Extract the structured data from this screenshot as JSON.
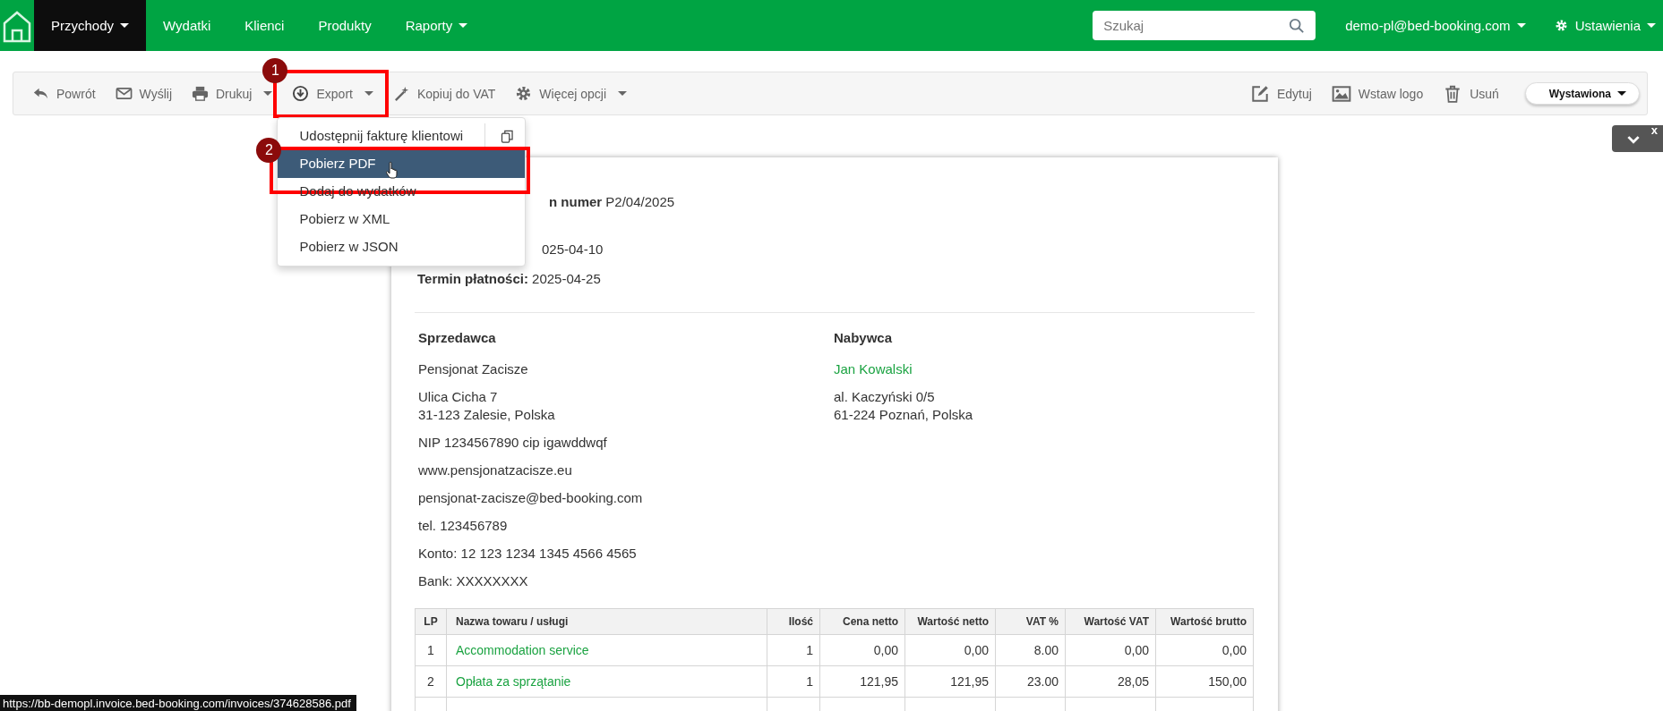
{
  "nav": {
    "items": [
      {
        "label": "Przychody",
        "caret": true,
        "selected": true
      },
      {
        "label": "Wydatki",
        "caret": false,
        "selected": false
      },
      {
        "label": "Klienci",
        "caret": false,
        "selected": false
      },
      {
        "label": "Produkty",
        "caret": false,
        "selected": false
      },
      {
        "label": "Raporty",
        "caret": true,
        "selected": false
      }
    ],
    "search": {
      "placeholder": "Szukaj"
    },
    "account": "demo-pl@bed-booking.com",
    "settings": "Ustawienia"
  },
  "toolbar": {
    "left": [
      {
        "label": "Powrót",
        "caret": false
      },
      {
        "label": "Wyślij",
        "caret": false
      },
      {
        "label": "Drukuj",
        "caret": true
      },
      {
        "label": "Export",
        "caret": true,
        "marker": "1"
      },
      {
        "label": "Kopiuj do VAT",
        "caret": false
      },
      {
        "label": "Więcej opcji",
        "caret": true
      }
    ],
    "right": [
      {
        "label": "Edytuj"
      },
      {
        "label": "Wstaw logo"
      },
      {
        "label": "Usuń"
      }
    ],
    "status": "Wystawiona"
  },
  "export_menu": {
    "items": [
      {
        "label": "Udostępnij fakturę klientowi",
        "kind": "share",
        "selected": false
      },
      {
        "label": "Pobierz PDF",
        "kind": "item",
        "selected": true,
        "marker": "2"
      },
      {
        "label": "Dodaj do wydatków",
        "kind": "item",
        "selected": false
      },
      {
        "label": "Pobierz w XML",
        "kind": "item",
        "selected": false
      },
      {
        "label": "Pobierz w JSON",
        "kind": "item",
        "selected": false
      }
    ]
  },
  "panel_toggle": {
    "close_label": "x"
  },
  "invoice": {
    "header": [
      {
        "text": "**n numer** P2/04/2025",
        "kind": "partial"
      },
      {
        "text": "025-04-10",
        "kind": "partial"
      },
      {
        "text": "**Termin płatności:** 2025-04-25",
        "kind": "full"
      }
    ],
    "seller": {
      "title": "Sprzedawca",
      "blocks": [
        [
          {
            "text": "Pensjonat Zacisze",
            "kind": "text"
          }
        ],
        [
          {
            "text": "Ulica Cicha 7",
            "kind": "text"
          },
          {
            "text": "31-123 Zalesie, Polska",
            "kind": "text"
          }
        ],
        [
          {
            "text": "NIP 1234567890 cip igawddwqf",
            "kind": "text"
          }
        ],
        [
          {
            "text": "www.pensjonatzacisze.eu",
            "kind": "text"
          }
        ],
        [
          {
            "text": "pensjonat-zacisze@bed-booking.com",
            "kind": "text"
          }
        ],
        [
          {
            "text": "tel. 123456789",
            "kind": "text"
          }
        ],
        [
          {
            "text": "Konto: 12 123 1234 1345 4566 4565",
            "kind": "text"
          }
        ],
        [
          {
            "text": "Bank: XXXXXXXX",
            "kind": "text"
          }
        ]
      ]
    },
    "buyer": {
      "title": "Nabywca",
      "blocks": [
        [
          {
            "text": "Jan Kowalski",
            "kind": "link"
          }
        ],
        [
          {
            "text": "al. Kaczyński 0/5",
            "kind": "text"
          },
          {
            "text": "61-224 Poznań, Polska",
            "kind": "text"
          }
        ]
      ]
    },
    "table": {
      "columns": [
        "LP",
        "Nazwa towaru / usługi",
        "Ilość",
        "Cena netto",
        "Wartość netto",
        "VAT %",
        "Wartość VAT",
        "Wartość brutto"
      ],
      "rows": [
        [
          "1",
          "Accommodation service",
          "1",
          "0,00",
          "0,00",
          "8.00",
          "0,00",
          "0,00"
        ],
        [
          "2",
          "Opłata za sprzątanie",
          "1",
          "121,95",
          "121,95",
          "23.00",
          "28,05",
          "150,00"
        ]
      ]
    }
  },
  "status_url": "https://bb-demopl.invoice.bed-booking.com/invoices/374628586.pdf"
}
